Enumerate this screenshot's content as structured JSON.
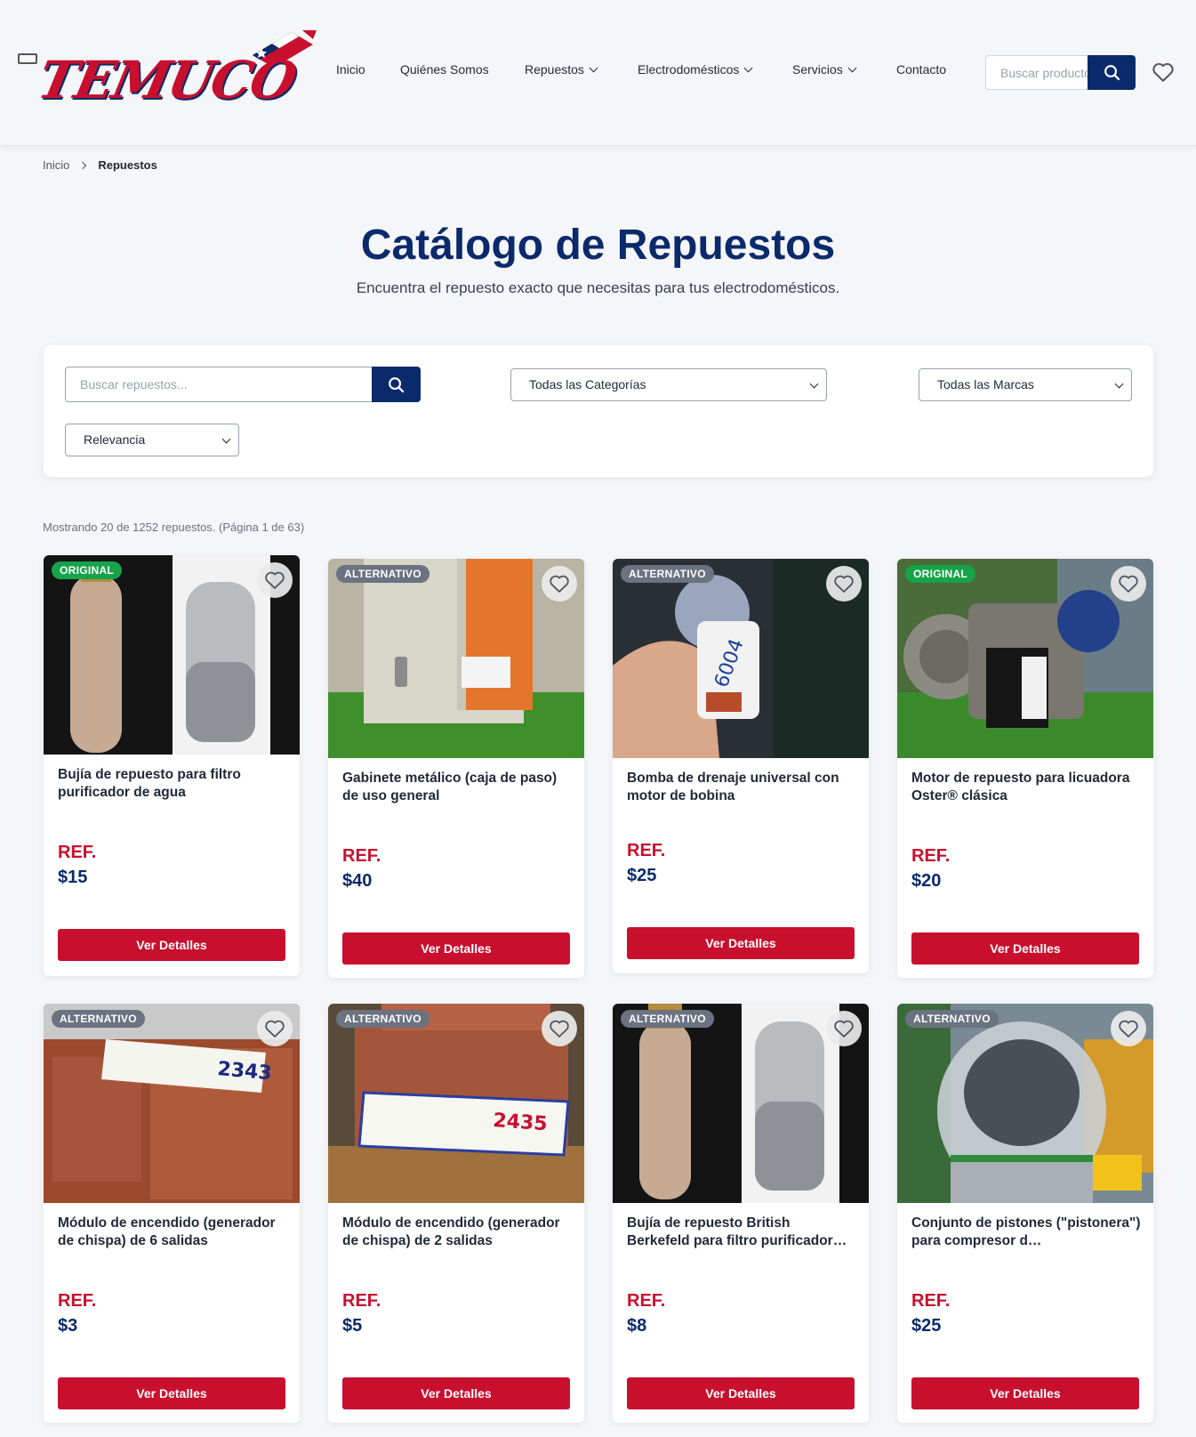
{
  "header": {
    "logo_text": "TEMUCO",
    "nav": [
      {
        "label": "Inicio",
        "has_dropdown": false
      },
      {
        "label": "Quiénes Somos",
        "has_dropdown": false
      },
      {
        "label": "Repuestos",
        "has_dropdown": true
      },
      {
        "label": "Electrodomésticos",
        "has_dropdown": true
      },
      {
        "label": "Servicios",
        "has_dropdown": true
      },
      {
        "label": "Contacto",
        "has_dropdown": false
      }
    ],
    "search_placeholder": "Buscar productos..."
  },
  "breadcrumb": {
    "home": "Inicio",
    "current": "Repuestos"
  },
  "hero": {
    "title": "Catálogo de Repuestos",
    "subtitle": "Encuentra el repuesto exacto que necesitas para tus electrodomésticos."
  },
  "filters": {
    "search_placeholder": "Buscar repuestos...",
    "category_selected": "Todas las Categorías",
    "brand_selected": "Todas las Marcas",
    "sort_selected": "Relevancia"
  },
  "results_text": "Mostrando 20 de 1252 repuestos. (Página 1 de 63)",
  "products": [
    {
      "badge": "ORIGINAL",
      "name": "Bujía de repuesto para filtro purificador de agua",
      "ref": "REF.",
      "price": "$15",
      "cta": "Ver Detalles"
    },
    {
      "badge": "ALTERNATIVO",
      "name": "Gabinete metálico (caja de paso) de uso general",
      "ref": "REF.",
      "price": "$40",
      "cta": "Ver Detalles"
    },
    {
      "badge": "ALTERNATIVO",
      "name": "Bomba de drenaje universal con motor de bobina",
      "ref": "REF.",
      "price": "$25",
      "cta": "Ver Detalles"
    },
    {
      "badge": "ORIGINAL",
      "name": "Motor de repuesto para licuadora Oster® clásica",
      "ref": "REF.",
      "price": "$20",
      "cta": "Ver Detalles"
    },
    {
      "badge": "ALTERNATIVO",
      "name": "Módulo de encendido (generador de chispa) de 6 salidas",
      "ref": "REF.",
      "price": "$3",
      "cta": "Ver Detalles"
    },
    {
      "badge": "ALTERNATIVO",
      "name": "Módulo de encendido (generador de chispa) de 2 salidas",
      "ref": "REF.",
      "price": "$5",
      "cta": "Ver Detalles"
    },
    {
      "badge": "ALTERNATIVO",
      "name": "Bujía de repuesto British Berkefeld para filtro purificador…",
      "ref": "REF.",
      "price": "$8",
      "cta": "Ver Detalles"
    },
    {
      "badge": "ALTERNATIVO",
      "name": "Conjunto de pistones (\"pistonera\") para compresor d…",
      "ref": "REF.",
      "price": "$25",
      "cta": "Ver Detalles"
    }
  ],
  "image_labels": {
    "p5": "2343",
    "p6": "2435",
    "p3": "6004"
  },
  "colors": {
    "brand_blue": "#0b2a6b",
    "brand_red": "#c8102e",
    "badge_original": "#16a34a",
    "badge_alternativo": "#6b7280"
  },
  "icons": [
    "search-icon",
    "heart-icon",
    "chevron-down-icon",
    "chevron-right-icon"
  ]
}
